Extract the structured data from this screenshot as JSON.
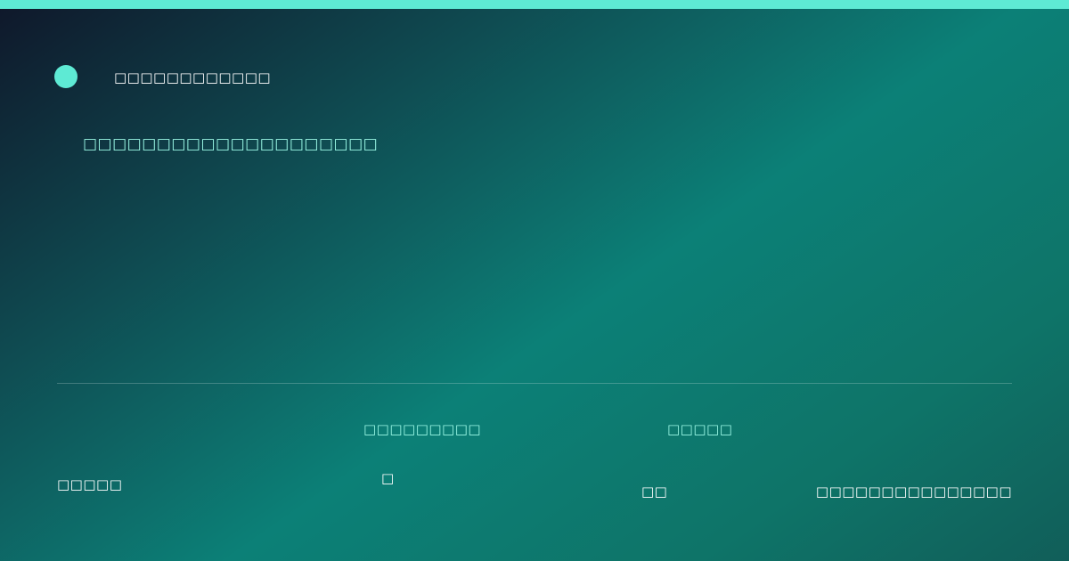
{
  "brand": {
    "name": "□□□□□□□□□□□□"
  },
  "headline": "□□□□□□□□□□□□□□□□□□□□",
  "footer": {
    "left_text": "□□□□□",
    "stat_1": {
      "label": "□□□□□□□□□",
      "value": "□"
    },
    "stat_2": {
      "label": "□□□□□",
      "value": "□□"
    },
    "right_text": "□□□□□□□□□□□□□□□"
  },
  "colors": {
    "accent": "#5eead4",
    "label": "#99f6e4",
    "text": "#ffffff",
    "bg_dark": "#0f172a",
    "bg_teal": "#0c8077"
  }
}
